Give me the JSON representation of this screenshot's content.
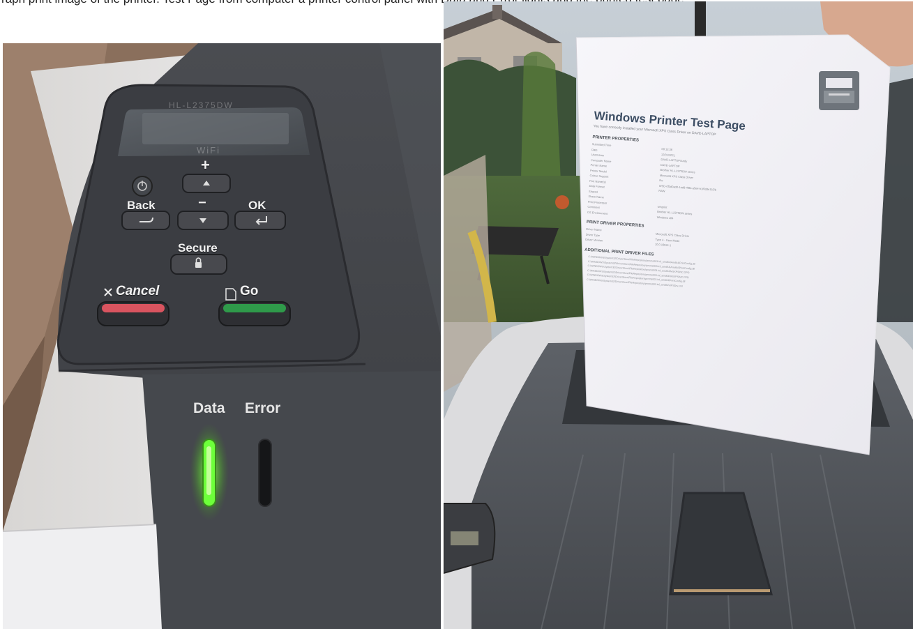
{
  "caption": "raph print image of the printer. Test Page from computer a printer control panel with Data and Error lights and the printed test page",
  "control_panel": {
    "brand_lcd_text": "HL-L2375DW",
    "wifi_label": "WiFi",
    "buttons": {
      "power": "power",
      "plus": "+",
      "back": "Back",
      "minus": "−",
      "ok": "OK",
      "secure": "Secure",
      "cancel": "Cancel",
      "go": "Go"
    },
    "status_lights": {
      "data_label": "Data",
      "error_label": "Error",
      "data_state": "on",
      "error_state": "off",
      "data_color": "#6dff3a"
    }
  },
  "test_page": {
    "title": "Windows Printer Test Page",
    "subtitle": "You have correctly installed your Microsoft XPS Class Driver on DAVE-LAPTOP",
    "printer_properties_heading": "PRINTER PROPERTIES",
    "printer_properties": [
      [
        "Submitted Time",
        "08:13:36"
      ],
      [
        "Date",
        "12/01/2021"
      ],
      [
        "Username",
        "DAVE-LAPTOP\\Andy"
      ],
      [
        "Computer Name",
        "DAVE-LAPTOP"
      ],
      [
        "Printer Name",
        "Brother HL-L2375DW series"
      ],
      [
        "Printer Model",
        "Microsoft XPS Class Driver"
      ],
      [
        "Colour Support",
        "No"
      ],
      [
        "Port Name(s)",
        "WSD-0f3d0ad0-1ad8-4f8b-a5e4-b1f6d3e11f2b"
      ],
      [
        "Data Format",
        "RAW"
      ],
      [
        "Shared",
        ""
      ],
      [
        "Share Name",
        ""
      ],
      [
        "Print Processor",
        "winprint"
      ],
      [
        "Comment",
        "Brother HL-L2375DW series"
      ],
      [
        "OS Environment",
        "Windows x64"
      ]
    ],
    "driver_properties_heading": "PRINT DRIVER PROPERTIES",
    "driver_properties": [
      [
        "Driver Name",
        "Microsoft XPS Class Driver"
      ],
      [
        "Driver Type",
        "Type 4 - User Mode"
      ],
      [
        "Driver Version",
        "10.0.19041.1"
      ]
    ],
    "driver_files_heading": "ADDITIONAL PRINT DRIVER FILES",
    "driver_files": [
      "C:\\WINDOWS\\System32\\DriverStore\\FileRepository\\prnms003.inf_amd64\\Amd64\\PrintConfig.dll",
      "C:\\WINDOWS\\System32\\DriverStore\\FileRepository\\prnms003.inf_amd64\\Amd64\\PrintConfig.dll",
      "C:\\WINDOWS\\System32\\DriverStore\\FileRepository\\prnms003.inf_amd64\\MSXPSINC.GPD",
      "C:\\WINDOWS\\System32\\DriverStore\\FileRepository\\prnms003.inf_amd64\\MSXPSINC.PPD",
      "C:\\WINDOWS\\System32\\DriverStore\\FileRepository\\prnms003.inf_amd64\\PrintConfig.dll",
      "C:\\WINDOWS\\System32\\DriverStore\\FileRepository\\prnms003.inf_amd64\\XPSDrv.xml"
    ]
  },
  "colors": {
    "printer_body": "#3f4247",
    "printer_white": "#e7e7ea",
    "cancel_button": "#d9545f",
    "go_button": "#2f9a4a",
    "paper": "#f4f3f7"
  }
}
